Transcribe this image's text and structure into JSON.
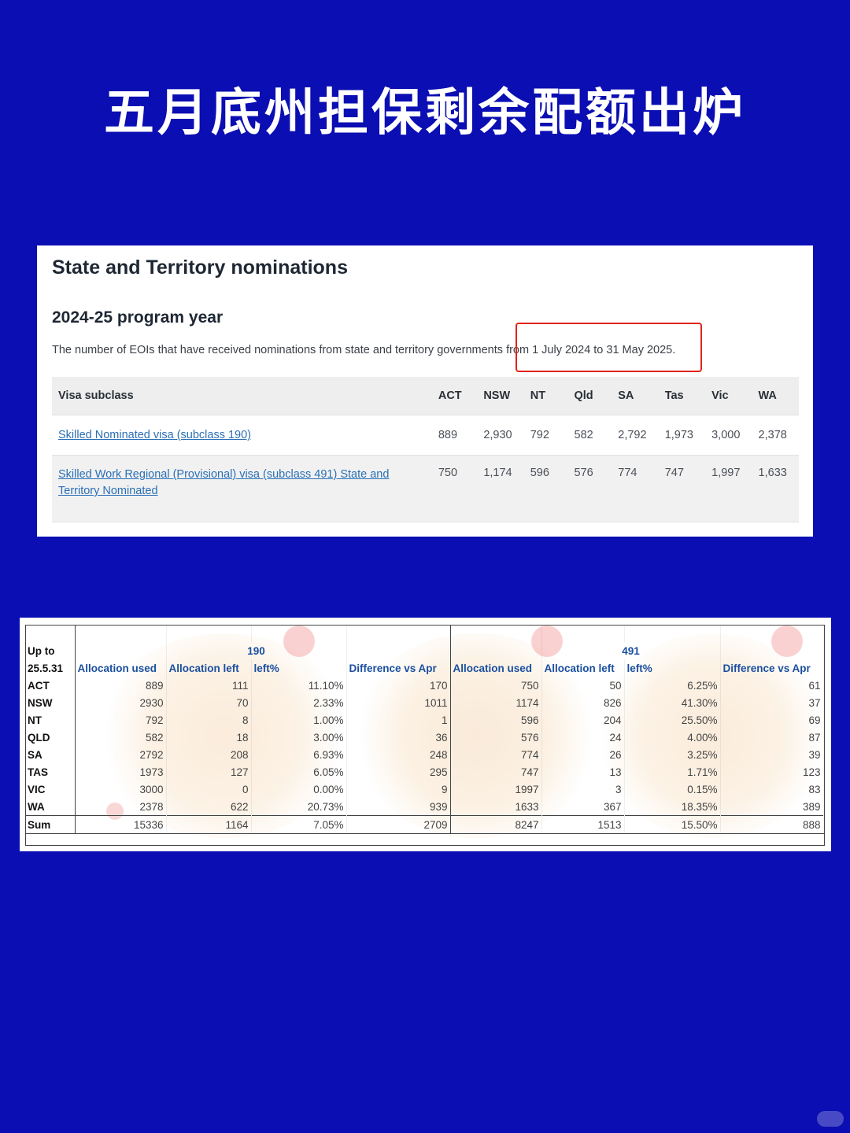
{
  "page_title": "五月底州担保剩余配额出炉",
  "nominations": {
    "heading": "State and Territory nominations",
    "program_year": "2024-25 program year",
    "description_prefix": "The number of EOIs that have received nominations from state and territory governments ",
    "description_highlight": "from 1 July 2024 to 31 May 2025.",
    "columns": [
      "Visa subclass",
      "ACT",
      "NSW",
      "NT",
      "Qld",
      "SA",
      "Tas",
      "Vic",
      "WA"
    ],
    "rows": [
      {
        "label": "Skilled Nominated visa (subclass 190)",
        "values": [
          "889",
          "2,930",
          "792",
          "582",
          "2,792",
          "1,973",
          "3,000",
          "2,378"
        ]
      },
      {
        "label": "Skilled Work Regional (Provisional) visa (subclass 491) State and Territory Nominated",
        "values": [
          "750",
          "1,174",
          "596",
          "576",
          "774",
          "747",
          "1,997",
          "1,633"
        ]
      }
    ]
  },
  "allocation": {
    "corner_top": "Up to",
    "corner_bottom": "25.5.31",
    "group_190": "190",
    "group_491": "491",
    "headers": [
      "Allocation used",
      "Allocation left",
      "left%",
      "Difference vs Apr",
      "Allocation used",
      "Allocation left",
      "left%",
      "Difference vs Apr"
    ],
    "rows": [
      {
        "state": "ACT",
        "values": [
          "889",
          "111",
          "11.10%",
          "170",
          "750",
          "50",
          "6.25%",
          "61"
        ]
      },
      {
        "state": "NSW",
        "values": [
          "2930",
          "70",
          "2.33%",
          "1011",
          "1174",
          "826",
          "41.30%",
          "37"
        ]
      },
      {
        "state": "NT",
        "values": [
          "792",
          "8",
          "1.00%",
          "1",
          "596",
          "204",
          "25.50%",
          "69"
        ]
      },
      {
        "state": "QLD",
        "values": [
          "582",
          "18",
          "3.00%",
          "36",
          "576",
          "24",
          "4.00%",
          "87"
        ]
      },
      {
        "state": "SA",
        "values": [
          "2792",
          "208",
          "6.93%",
          "248",
          "774",
          "26",
          "3.25%",
          "39"
        ]
      },
      {
        "state": "TAS",
        "values": [
          "1973",
          "127",
          "6.05%",
          "295",
          "747",
          "13",
          "1.71%",
          "123"
        ]
      },
      {
        "state": "VIC",
        "values": [
          "3000",
          "0",
          "0.00%",
          "9",
          "1997",
          "3",
          "0.15%",
          "83"
        ]
      },
      {
        "state": "WA",
        "values": [
          "2378",
          "622",
          "20.73%",
          "939",
          "1633",
          "367",
          "18.35%",
          "389"
        ]
      },
      {
        "state": "Sum",
        "values": [
          "15336",
          "1164",
          "7.05%",
          "2709",
          "8247",
          "1513",
          "15.50%",
          "888"
        ]
      }
    ]
  },
  "colors": {
    "background": "#0b0eb2",
    "highlight_box": "#e2231a",
    "link": "#2a6fb5",
    "sheet_header": "#1a4fa0"
  }
}
